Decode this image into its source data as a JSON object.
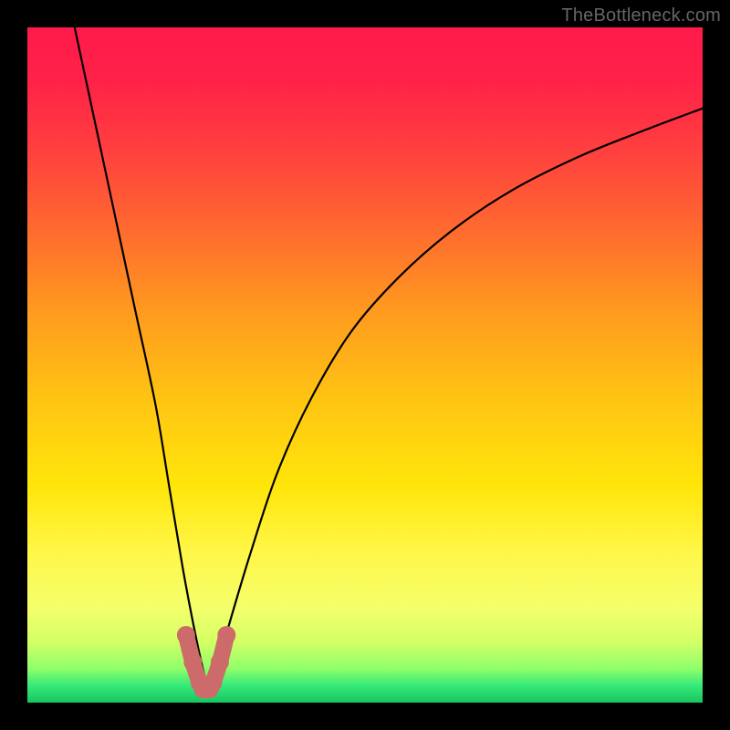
{
  "watermark": "TheBottleneck.com",
  "chart_data": {
    "type": "line",
    "title": "",
    "xlabel": "",
    "ylabel": "",
    "xlim": [
      0,
      100
    ],
    "ylim": [
      0,
      100
    ],
    "grid": false,
    "series": [
      {
        "name": "bottleneck-curve",
        "x": [
          7,
          10,
          13,
          16,
          19,
          21,
          23,
          24.5,
          26,
          27,
          28,
          30,
          33,
          37,
          42,
          48,
          55,
          63,
          72,
          82,
          92,
          100
        ],
        "y": [
          100,
          86,
          72,
          58,
          44,
          32,
          20,
          12,
          5,
          2,
          5,
          12,
          22,
          34,
          45,
          55,
          63,
          70,
          76,
          81,
          85,
          88
        ]
      },
      {
        "name": "highlight-valley",
        "x": [
          23.5,
          24.5,
          25.5,
          26,
          26.5,
          27,
          27.5,
          28.5,
          29.5
        ],
        "y": [
          10,
          6,
          3,
          2,
          2,
          2,
          3,
          6,
          10
        ]
      }
    ],
    "background_gradient_stops": [
      {
        "offset": 0.0,
        "color": "#ff1a4b"
      },
      {
        "offset": 0.08,
        "color": "#ff2248"
      },
      {
        "offset": 0.18,
        "color": "#ff3f3f"
      },
      {
        "offset": 0.3,
        "color": "#ff6a2f"
      },
      {
        "offset": 0.42,
        "color": "#ff9a1f"
      },
      {
        "offset": 0.55,
        "color": "#ffc413"
      },
      {
        "offset": 0.68,
        "color": "#ffe60a"
      },
      {
        "offset": 0.78,
        "color": "#fff74a"
      },
      {
        "offset": 0.86,
        "color": "#f4ff6a"
      },
      {
        "offset": 0.91,
        "color": "#d4ff66"
      },
      {
        "offset": 0.95,
        "color": "#8eff6a"
      },
      {
        "offset": 0.975,
        "color": "#35e97a"
      },
      {
        "offset": 1.0,
        "color": "#17c65e"
      }
    ],
    "colors": {
      "curve": "#000000",
      "highlight": "#cd6a6a",
      "frame": "#000000"
    }
  }
}
